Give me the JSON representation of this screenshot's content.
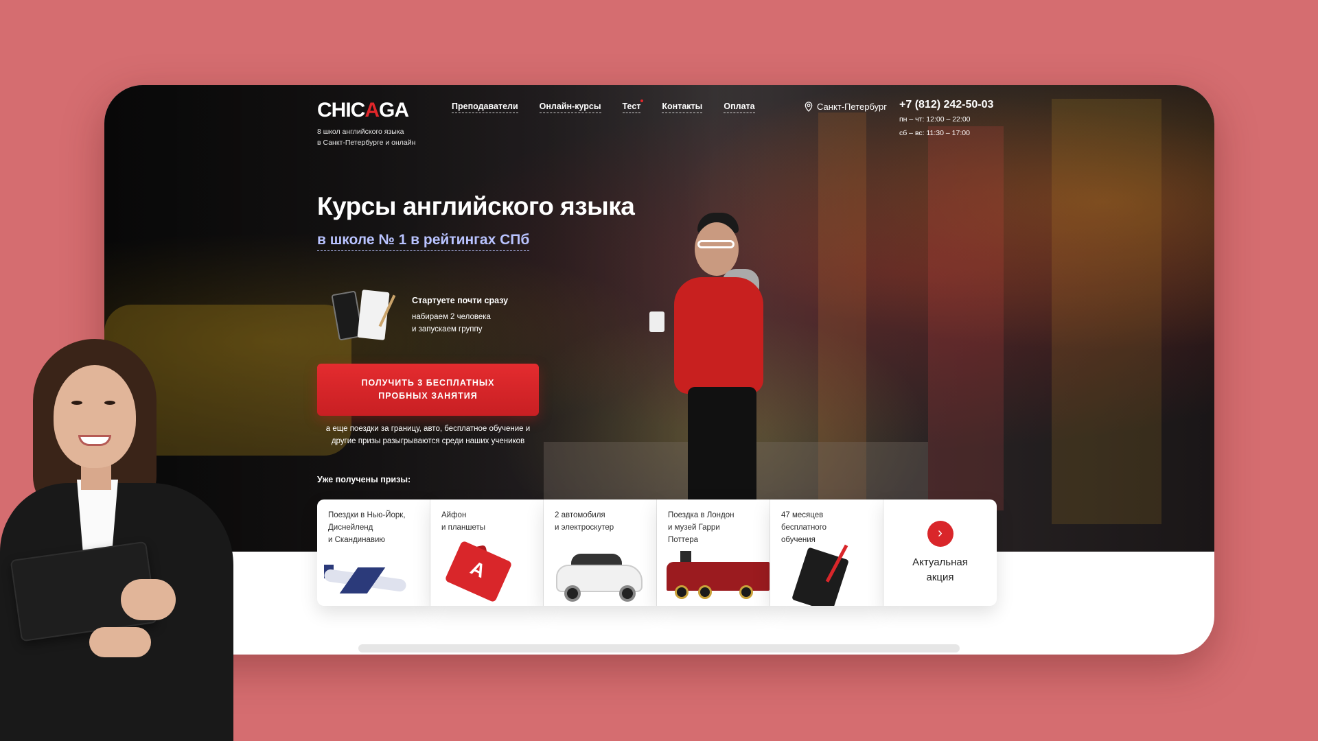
{
  "header": {
    "logo_main": "CHIC",
    "logo_accent": "A",
    "logo_end": "GA",
    "logo_sub_line1": "8 школ английского языка",
    "logo_sub_line2": "в Санкт-Петербурге и онлайн",
    "nav": [
      {
        "label": "Преподаватели"
      },
      {
        "label": "Онлайн-курсы"
      },
      {
        "label": "Тест"
      },
      {
        "label": "Контакты"
      },
      {
        "label": "Оплата"
      }
    ],
    "city": "Санкт-Петербург",
    "phone": "+7 (812) 242-50-03",
    "hours_weekdays": "пн – чт: 12:00 – 22:00",
    "hours_weekend": "сб – вс: 11:30 – 17:00"
  },
  "hero": {
    "title": "Курсы английского языка",
    "subtitle": "в школе № 1 в рейтингах СПб",
    "start_title": "Стартуете почти сразу",
    "start_line1": "набираем 2 человека",
    "start_line2": "и запускаем группу",
    "cta_label": "ПОЛУЧИТЬ 3 БЕСПЛАТНЫХ ПРОБНЫХ ЗАНЯТИЯ",
    "note_line1": "а еще поездки за границу, авто, бесплатное обучение и",
    "note_line2": "другие призы разыгрываются среди наших учеников"
  },
  "prizes": {
    "label": "Уже получены призы:",
    "cards": [
      {
        "line1": "Поездки в Нью-Йорк,",
        "line2": "Диснейленд",
        "line3": "и Скандинавию",
        "icon": "plane-icon"
      },
      {
        "line1": "Айфон",
        "line2": "и планшеты",
        "line3": "",
        "icon": "phone-icon"
      },
      {
        "line1": "2 автомобиля",
        "line2": "и электроскутер",
        "line3": "",
        "icon": "car-icon"
      },
      {
        "line1": "Поездка в Лондон",
        "line2": "и музей Гарри",
        "line3": "Поттера",
        "icon": "train-icon"
      },
      {
        "line1": "47 месяцев",
        "line2": "бесплатного",
        "line3": "обучения",
        "icon": "notebook-icon"
      }
    ],
    "action_line1": "Актуальная",
    "action_line2": "акция",
    "action_icon": "chevron-right-icon"
  },
  "colors": {
    "background": "#d56d70",
    "accent": "#d9262a",
    "subtitle": "#b9c3ff"
  }
}
